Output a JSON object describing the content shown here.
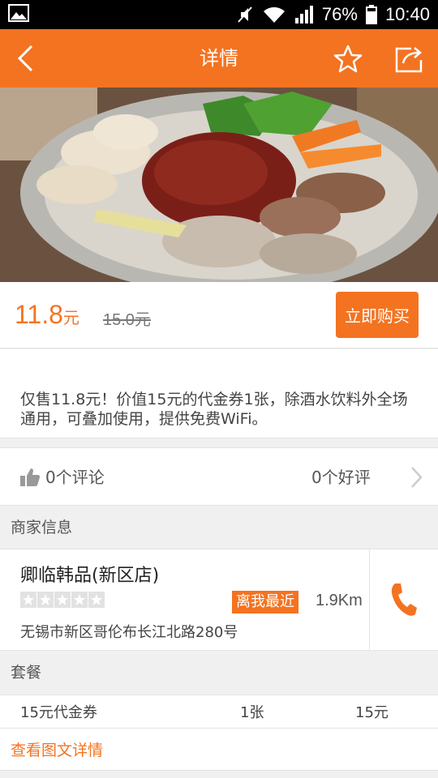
{
  "status_bar": {
    "battery": "76%",
    "time": "10:40"
  },
  "header": {
    "title": "详情"
  },
  "price": {
    "current": "11.8",
    "current_unit": "元",
    "original": "15.0元",
    "buy_label": "立即购买"
  },
  "description": "仅售11.8元！价值15元的代金券1张，除酒水饮料外全场通用，可叠加使用，提供免费WiFi。",
  "reviews": {
    "comments": "0个评论",
    "positive": "0个好评"
  },
  "merchant_section": {
    "header": "商家信息",
    "name": "卿临韩品(新区店)",
    "rating": 0,
    "nearest_badge": "离我最近",
    "distance": "1.9Km",
    "address": "无锡市新区哥伦布长江北路280号"
  },
  "package_section": {
    "header": "套餐",
    "items": [
      {
        "name": "15元代金券",
        "qty": "1张",
        "price": "15元"
      }
    ],
    "detail_link": "查看图文详情"
  },
  "colors": {
    "accent": "#f47321",
    "background": "#f0f0f0"
  }
}
